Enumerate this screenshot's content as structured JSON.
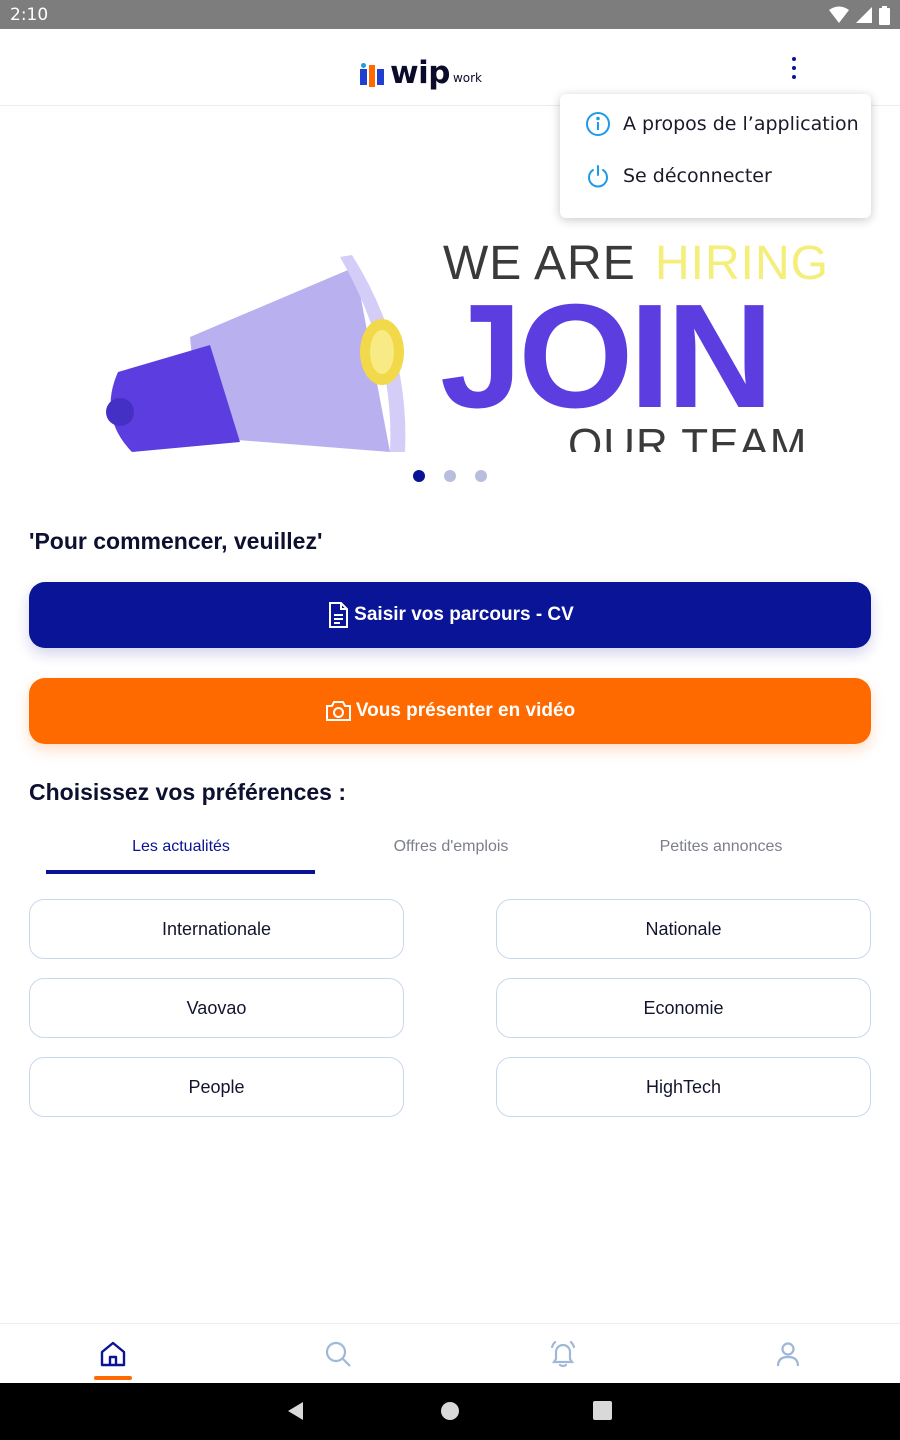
{
  "status_bar": {
    "time": "2:10"
  },
  "app_bar": {
    "logo_text": "wip",
    "logo_sub": "work",
    "menu_icon": "more-vertical-icon"
  },
  "banner": {
    "line1_a": "WE ARE ",
    "line1_b": "HIRING",
    "line2": "JOIN",
    "line3": "OUR TEAM",
    "slides_count": 3,
    "active_slide": 0
  },
  "intro": {
    "text": "'Pour commencer, veuillez'"
  },
  "actions": {
    "cv_label": "Saisir vos parcours - CV",
    "cv_icon": "document-icon",
    "video_label": "Vous présenter en  vidéo",
    "video_icon": "camera-icon"
  },
  "preferences": {
    "title": "Choisissez vos préférences :",
    "tabs": [
      {
        "label": "Les actualités"
      },
      {
        "label": "Offres d'emplois"
      },
      {
        "label": "Petites annonces"
      }
    ],
    "active_tab": 0,
    "chips": [
      {
        "label": "Internationale"
      },
      {
        "label": "Nationale"
      },
      {
        "label": "Vaovao"
      },
      {
        "label": "Economie"
      },
      {
        "label": "People"
      },
      {
        "label": "HighTech"
      }
    ]
  },
  "menu": {
    "items": [
      {
        "label": "A propos de l’application",
        "icon": "info-icon"
      },
      {
        "label": "Se déconnecter",
        "icon": "power-icon"
      }
    ]
  },
  "bottom_nav": {
    "items": [
      {
        "icon": "home-icon"
      },
      {
        "icon": "search-icon"
      },
      {
        "icon": "bell-icon"
      },
      {
        "icon": "user-icon"
      }
    ],
    "active": 0
  },
  "colors": {
    "primary": "#0a1496",
    "accent": "#ff6a00",
    "banner_purple": "#5c3de0",
    "banner_yellow": "#f4ee7a",
    "icon_blue": "#1e9be8"
  }
}
